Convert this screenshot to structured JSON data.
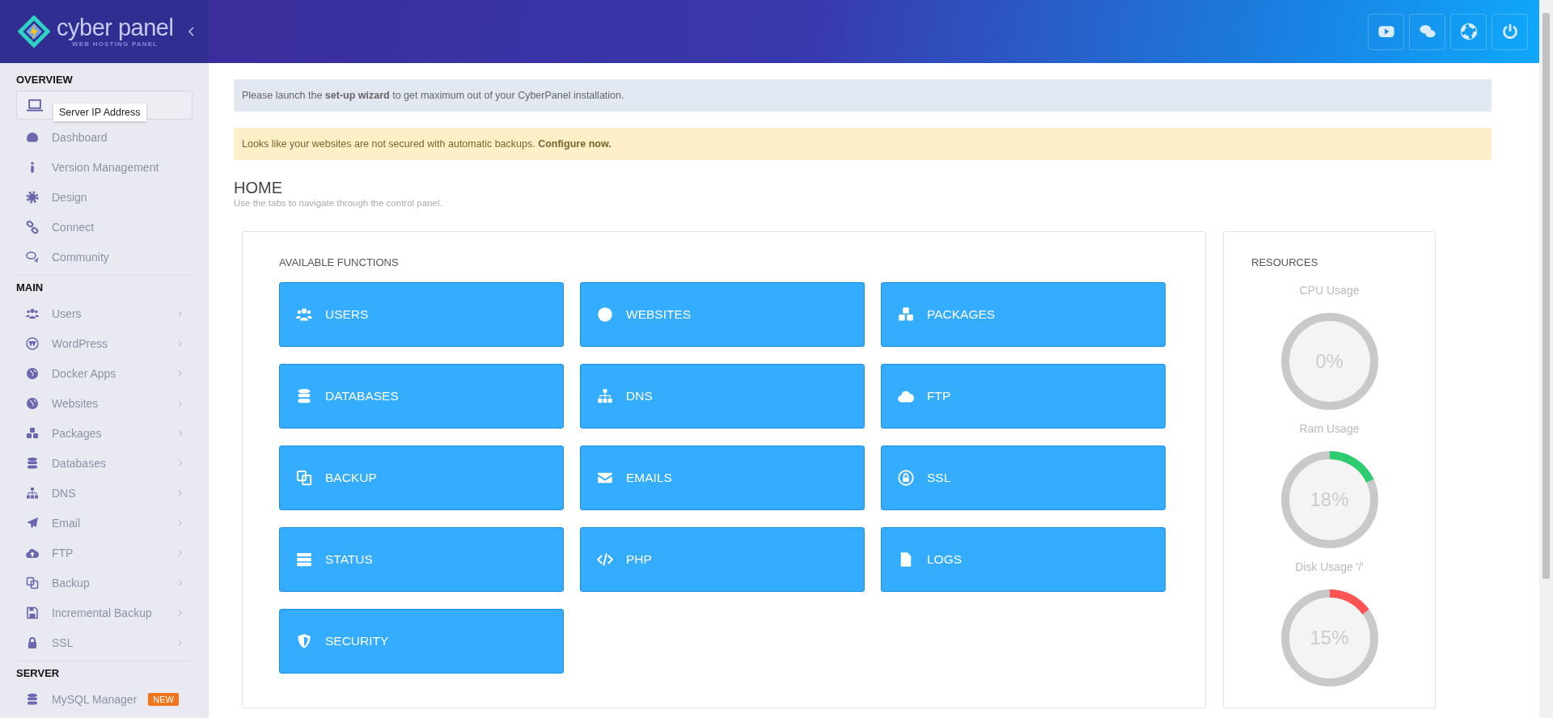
{
  "brand": {
    "name": "cyber panel",
    "tagline": "WEB HOSTING PANEL"
  },
  "sidebar": {
    "sections": [
      {
        "heading": "OVERVIEW",
        "ip_field": {
          "tooltip": "Server IP Address"
        },
        "items": [
          {
            "label": "Dashboard",
            "submenu": false
          },
          {
            "label": "Version Management",
            "submenu": false
          },
          {
            "label": "Design",
            "submenu": false
          },
          {
            "label": "Connect",
            "submenu": false
          },
          {
            "label": "Community",
            "submenu": false
          }
        ]
      },
      {
        "heading": "MAIN",
        "items": [
          {
            "label": "Users",
            "submenu": true
          },
          {
            "label": "WordPress",
            "submenu": true
          },
          {
            "label": "Docker Apps",
            "submenu": true
          },
          {
            "label": "Websites",
            "submenu": true
          },
          {
            "label": "Packages",
            "submenu": true
          },
          {
            "label": "Databases",
            "submenu": true
          },
          {
            "label": "DNS",
            "submenu": true
          },
          {
            "label": "Email",
            "submenu": true
          },
          {
            "label": "FTP",
            "submenu": true
          },
          {
            "label": "Backup",
            "submenu": true
          },
          {
            "label": "Incremental Backup",
            "submenu": true
          },
          {
            "label": "SSL",
            "submenu": true
          }
        ]
      },
      {
        "heading": "SERVER",
        "items": [
          {
            "label": "MySQL Manager",
            "submenu": false,
            "badge": "NEW"
          }
        ]
      }
    ]
  },
  "alerts": [
    {
      "kind": "info",
      "text": "Please launch the **set-up wizard** to get maximum out of your CyberPanel installation."
    },
    {
      "kind": "warning",
      "text": "Looks like your websites are not secured with automatic backups. **Configure now.**"
    }
  ],
  "page": {
    "title": "HOME",
    "subtitle": "Use the tabs to navigate through the control panel."
  },
  "functions": {
    "title": "AVAILABLE FUNCTIONS",
    "tiles": [
      {
        "label": "USERS"
      },
      {
        "label": "WEBSITES"
      },
      {
        "label": "PACKAGES"
      },
      {
        "label": "DATABASES"
      },
      {
        "label": "DNS"
      },
      {
        "label": "FTP"
      },
      {
        "label": "BACKUP"
      },
      {
        "label": "EMAILS"
      },
      {
        "label": "SSL"
      },
      {
        "label": "STATUS"
      },
      {
        "label": "PHP"
      },
      {
        "label": "LOGS"
      },
      {
        "label": "SECURITY"
      }
    ]
  },
  "resources": {
    "title": "RESOURCES",
    "gauges": [
      {
        "label": "CPU Usage",
        "reading": "0%",
        "level": 0
      },
      {
        "label": "Ram Usage",
        "reading": "18%",
        "level": 0.18,
        "color": "#2ecc71"
      },
      {
        "label": "Disk Usage '/'",
        "reading": "15%",
        "level": 0.15,
        "color": "#ff5252"
      }
    ]
  }
}
